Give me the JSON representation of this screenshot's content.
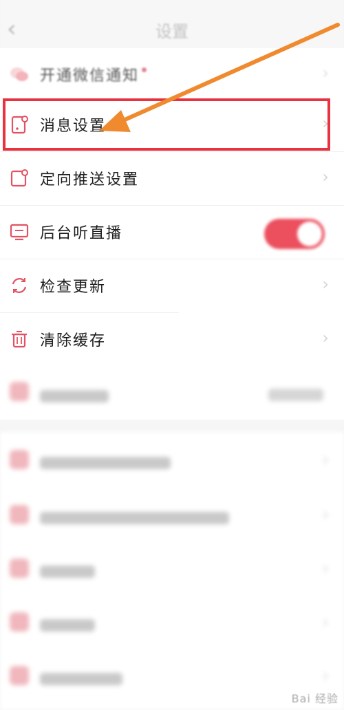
{
  "header": {
    "back_icon": "chevron-left-icon",
    "title": "设置"
  },
  "settings": [
    {
      "id": "wechat-notify",
      "label": "开通微信通知",
      "icon": "wechat-icon",
      "badge": "dot"
    },
    {
      "id": "message",
      "label": "消息设置",
      "icon": "message-settings-icon"
    },
    {
      "id": "push",
      "label": "定向推送设置",
      "icon": "push-settings-icon"
    },
    {
      "id": "background-listen",
      "label": "后台听直播",
      "icon": "tv-icon",
      "toggle_on": true
    },
    {
      "id": "update",
      "label": "检查更新",
      "icon": "refresh-icon"
    },
    {
      "id": "clear-cache",
      "label": "清除缓存",
      "icon": "trash-icon"
    }
  ],
  "colors": {
    "accent": "#ec4f5e",
    "highlight_box": "#e8323f",
    "arrow": "#f08a2e"
  },
  "watermark": "Bai 经验"
}
